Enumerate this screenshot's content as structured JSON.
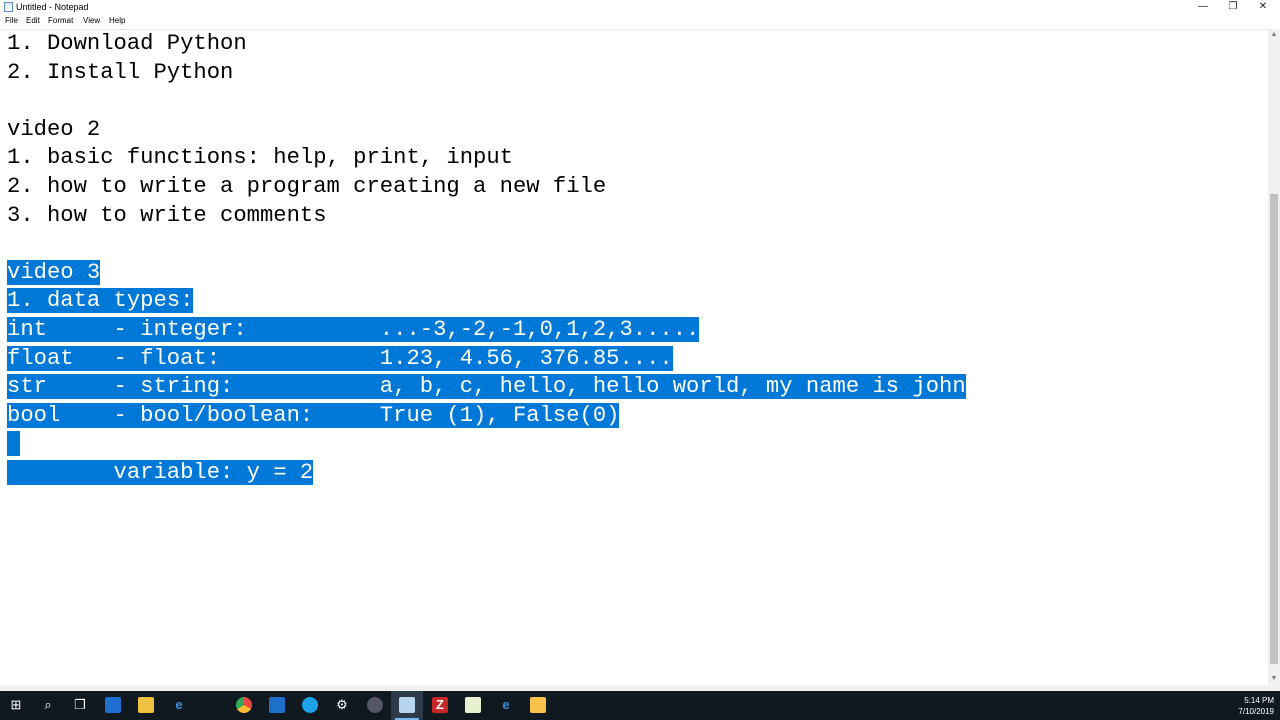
{
  "window": {
    "title": "Untitled - Notepad",
    "controls": {
      "minimize": "—",
      "restore": "❐",
      "close": "✕"
    }
  },
  "menu": {
    "items": [
      "File",
      "Edit",
      "Format",
      "View",
      "Help"
    ]
  },
  "editor": {
    "selection_color": "#0078d7",
    "lines": [
      {
        "text": "1. Download Python",
        "selected": false
      },
      {
        "text": "2. Install Python",
        "selected": false
      },
      {
        "text": "",
        "selected": false
      },
      {
        "text": "video 2",
        "selected": false
      },
      {
        "text": "1. basic functions: help, print, input",
        "selected": false
      },
      {
        "text": "2. how to write a program creating a new file",
        "selected": false
      },
      {
        "text": "3. how to write comments",
        "selected": false
      },
      {
        "text": "",
        "selected": false
      },
      {
        "text": "video 3",
        "selected": true
      },
      {
        "text": "1. data types:",
        "selected": true
      },
      {
        "text": "int     - integer:          ...-3,-2,-1,0,1,2,3.....",
        "selected": true
      },
      {
        "text": "float   - float:            1.23, 4.56, 376.85....",
        "selected": true
      },
      {
        "text": "str     - string:           a, b, c, hello, hello world, my name is john",
        "selected": true
      },
      {
        "text": "bool    - bool/boolean:     True (1), False(0)",
        "selected": true
      },
      {
        "text": "",
        "selected": true
      },
      {
        "text": "        variable: y = 2",
        "selected": true
      }
    ]
  },
  "taskbar": {
    "icons": [
      "windows-start-icon",
      "search-icon",
      "task-view-icon",
      "store-icon",
      "file-explorer-icon",
      "edge-icon",
      "chrome-icon",
      "outlook-icon",
      "skype-icon",
      "settings-icon",
      "davinci-resolve-icon",
      "notepad-icon",
      "filezilla-icon",
      "notepad-plus-icon",
      "ie-icon",
      "media-player-icon"
    ],
    "time": "5:14 PM",
    "date": "7/10/2019"
  }
}
